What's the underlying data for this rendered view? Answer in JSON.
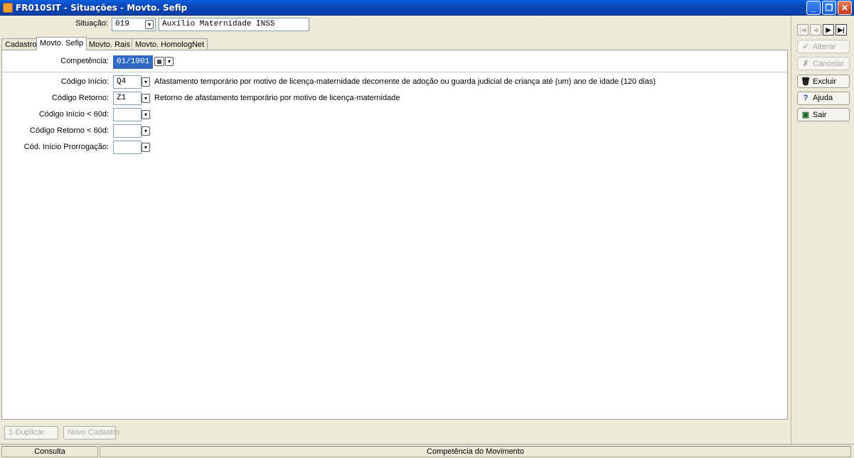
{
  "window": {
    "title": "FR010SIT - Situações - Movto. Sefip",
    "min": "_",
    "max": "❐",
    "close": "✕"
  },
  "situacao": {
    "label": "Situação:",
    "code": "019",
    "description": "Auxílio Maternidade INSS"
  },
  "tabs": [
    {
      "label": "Cadastro"
    },
    {
      "label": "Movto. Sefip"
    },
    {
      "label": "Movto. Rais"
    },
    {
      "label": "Movto. HomologNet"
    }
  ],
  "competencia": {
    "label": "Competência:",
    "value": "01/1901"
  },
  "fields": [
    {
      "label": "Código Início:",
      "code": "Q4",
      "description": "Afastamento temporário por motivo de licença-maternidade decorrente de adoção ou guarda judicial de criança até (um) ano de idade (120 dias)"
    },
    {
      "label": "Código Retorno:",
      "code": "Z1",
      "description": "Retorno de afastamento temporário por motivo de licença-maternidade"
    },
    {
      "label": "Código Início < 60d:",
      "code": "",
      "description": ""
    },
    {
      "label": "Código Retorno < 60d:",
      "code": "",
      "description": ""
    },
    {
      "label": "Cód. Início Prorrogação:",
      "code": "",
      "description": ""
    }
  ],
  "footer": {
    "duplicar": "1-Duplicar",
    "novo": "Novo Cadastro"
  },
  "nav": {
    "first": "|◀",
    "prev": "◀",
    "next": "▶",
    "last": "▶|"
  },
  "side": {
    "alterar": "Alterar",
    "cancelar": "Cancelar",
    "excluir": "Excluir",
    "ajuda": "Ajuda",
    "sair": "Sair"
  },
  "status": {
    "mode": "Consulta",
    "hint": "Competência do Movimento"
  }
}
